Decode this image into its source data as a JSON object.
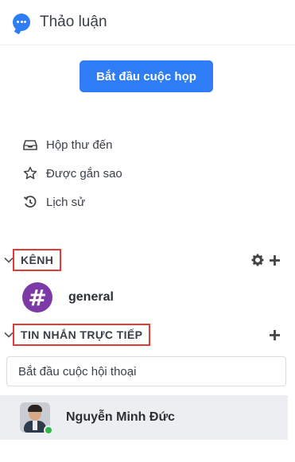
{
  "header": {
    "title": "Thảo luận",
    "icon": "chat-bubble-icon"
  },
  "actions": {
    "start_meeting": "Bắt đầu cuộc họp"
  },
  "nav": {
    "items": [
      {
        "label": "Hộp thư đến",
        "icon": "inbox-icon"
      },
      {
        "label": "Được gắn sao",
        "icon": "star-icon"
      },
      {
        "label": "Lịch sử",
        "icon": "history-icon"
      }
    ]
  },
  "channels": {
    "title": "KÊNH",
    "items": [
      {
        "name": "general",
        "icon": "#"
      }
    ]
  },
  "direct_messages": {
    "title": "TIN NHẮN TRỰC TIẾP",
    "placeholder": "Bắt đầu cuộc hội thoại",
    "items": [
      {
        "name": "Nguyễn Minh Đức",
        "status": "online"
      }
    ]
  },
  "colors": {
    "accent": "#2f7df6",
    "channel_icon": "#7b3aa6",
    "highlight_border": "#e53935",
    "online": "#2eb84b",
    "selected_row": "#eceef1"
  }
}
